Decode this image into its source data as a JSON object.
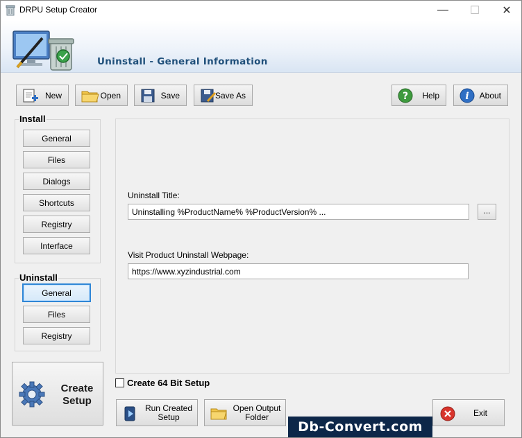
{
  "window": {
    "title": "DRPU Setup Creator",
    "minimize": "—",
    "maximize": "☐",
    "close": "✕"
  },
  "header": {
    "title": "Uninstall - General Information"
  },
  "toolbar": {
    "new_label": "New",
    "open_label": "Open",
    "save_label": "Save",
    "save_as_label": "Save As",
    "help_label": "Help",
    "about_label": "About"
  },
  "sidebar": {
    "install": {
      "title": "Install",
      "items": [
        {
          "label": "General"
        },
        {
          "label": "Files"
        },
        {
          "label": "Dialogs"
        },
        {
          "label": "Shortcuts"
        },
        {
          "label": "Registry"
        },
        {
          "label": "Interface"
        }
      ]
    },
    "uninstall": {
      "title": "Uninstall",
      "items": [
        {
          "label": "General",
          "selected": true
        },
        {
          "label": "Files"
        },
        {
          "label": "Registry"
        }
      ]
    }
  },
  "main": {
    "uninstall_title_label": "Uninstall Title:",
    "uninstall_title_value": "Uninstalling %ProductName% %ProductVersion% ...",
    "browse_label": "...",
    "webpage_label": "Visit Product Uninstall Webpage:",
    "webpage_value": "https://www.xyzindustrial.com"
  },
  "bottom": {
    "create_setup_line1": "Create",
    "create_setup_line2": "Setup",
    "checkbox_label": "Create 64 Bit Setup",
    "checkbox_checked": false,
    "run_created_line1": "Run Created",
    "run_created_line2": "Setup",
    "open_output_line1": "Open Output",
    "open_output_line2": "Folder",
    "exit_label": "Exit"
  },
  "watermark": {
    "text": "Db-Convert.com"
  },
  "colors": {
    "header_title": "#1f4f7a",
    "selected_border": "#2f86d6",
    "watermark_bg": "#0d2749"
  }
}
